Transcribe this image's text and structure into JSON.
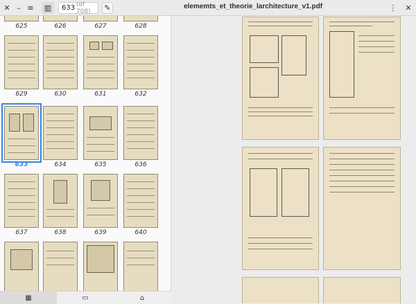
{
  "titlebar": {
    "page_number": "633",
    "page_total": "(of 708)",
    "document_title": "elememts_et_theorie_larchitecture_v1.pdf",
    "icons": [
      "close-icon",
      "minimize-icon",
      "maximize-icon",
      "sidebar-toggle-icon",
      "edit-icon",
      "menu-icon"
    ]
  },
  "sidebar": {
    "thumbnails": [
      {
        "label": "625"
      },
      {
        "label": "626"
      },
      {
        "label": "627"
      },
      {
        "label": "628"
      },
      {
        "label": "629"
      },
      {
        "label": "630"
      },
      {
        "label": "631"
      },
      {
        "label": "632"
      },
      {
        "label": "633",
        "selected": true
      },
      {
        "label": "634"
      },
      {
        "label": "635"
      },
      {
        "label": "636"
      },
      {
        "label": "637"
      },
      {
        "label": "638"
      },
      {
        "label": "639"
      },
      {
        "label": "640"
      }
    ],
    "accent": "#3584e4"
  },
  "bottombar": {
    "tabs": [
      "thumbnails-icon",
      "annotations-icon",
      "bookmarks-icon"
    ]
  }
}
